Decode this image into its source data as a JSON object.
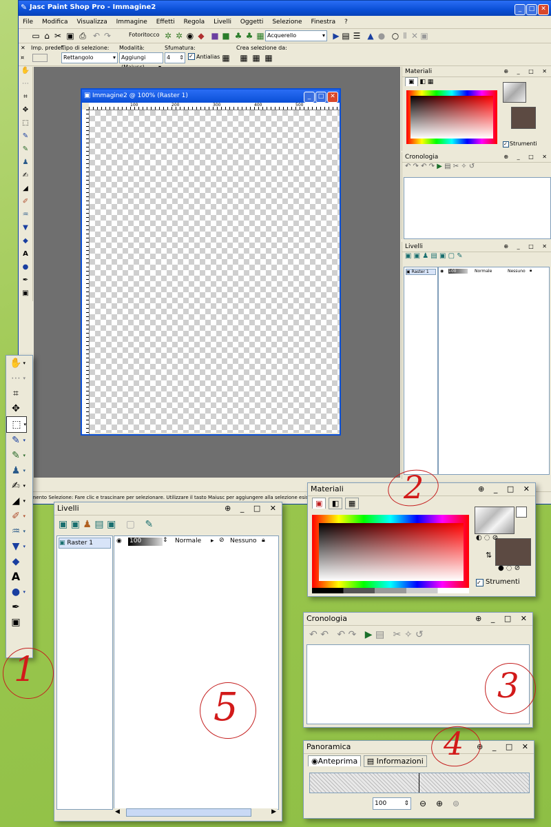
{
  "window": {
    "title": "Jasc Paint Shop Pro - Immagine2"
  },
  "menu": [
    "File",
    "Modifica",
    "Visualizza",
    "Immagine",
    "Effetti",
    "Regola",
    "Livelli",
    "Oggetti",
    "Selezione",
    "Finestra",
    "?"
  ],
  "toolbar": {
    "photo_label": "Fotoritocco",
    "preset": "Acquerello"
  },
  "options": {
    "preset_label": "Imp. predef.:",
    "type_label": "Tipo di selezione:",
    "type_value": "Rettangolo",
    "mode_label": "Modalità:",
    "mode_value": "Aggiungi (Maiusc)",
    "feather_label": "Sfumatura:",
    "feather_value": "4",
    "antialias": "Antialias",
    "create_label": "Crea selezione da:"
  },
  "document": {
    "title": "Immagine2 @ 100% (Raster 1)",
    "ruler": [
      "100",
      "200",
      "300",
      "400",
      "500"
    ]
  },
  "status": {
    "text": "Strumento Selezione: Fare clic e trascinare per selezionare. Utilizzare il tasto Maiusc per aggiungere alla selezione esistente o Ctrl per rimuovere."
  },
  "small_panels": {
    "materials": "Materiali",
    "strumenti": "Strumenti",
    "history": "Cronologia",
    "layers": "Livelli",
    "layer_name": "Raster 1",
    "opacity": "100",
    "blend": "Normale",
    "mask": "Nessuno"
  },
  "big_layers": {
    "title": "Livelli",
    "layer_name": "Raster 1",
    "opacity": "100",
    "blend": "Normale",
    "mask": "Nessuno"
  },
  "big_materials": {
    "title": "Materiali",
    "strumenti": "Strumenti"
  },
  "big_history": {
    "title": "Cronologia"
  },
  "overview": {
    "title": "Panoramica",
    "tab_preview": "Anteprima",
    "tab_info": "Informazioni",
    "zoom": "100"
  },
  "callouts": [
    "1",
    "2",
    "3",
    "4",
    "5"
  ],
  "colors": {
    "titlebar": "#0a4fd6",
    "background": "#9cc74f",
    "workspace": "#6f6f6f",
    "callout": "#d21a1a"
  }
}
